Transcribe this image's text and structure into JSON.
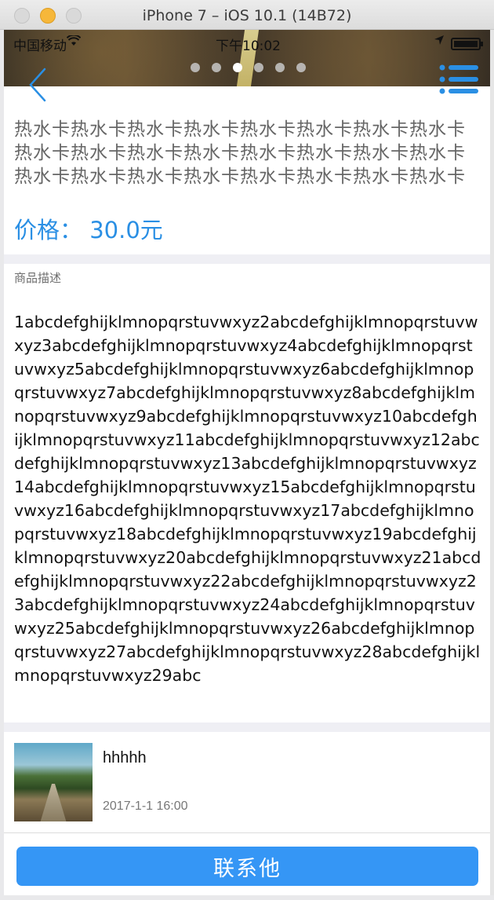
{
  "window": {
    "title": "iPhone 7 – iOS 10.1 (14B72)"
  },
  "status_bar": {
    "carrier": "中国移动",
    "wifi_icon": "wifi-icon",
    "time": "下午10:02",
    "location_icon": "location-arrow-icon",
    "battery_icon": "battery-icon"
  },
  "header": {
    "back_icon": "chevron-left-icon",
    "menu_icon": "list-menu-icon",
    "pager": {
      "count": 6,
      "active_index": 2
    }
  },
  "product": {
    "title": "热水卡热水卡热水卡热水卡热水卡热水卡热水卡热水卡热水卡热水卡热水卡热水卡热水卡热水卡热水卡热水卡热水卡热水卡热水卡热水卡热水卡热水卡热水卡热水卡",
    "price": "价格： 30.0元"
  },
  "description": {
    "label": "商品描述",
    "text": "1abcdefghijklmnopqrstuvwxyz2abcdefghijklmnopqrstuvwxyz3abcdefghijklmnopqrstuvwxyz4abcdefghijklmnopqrstuvwxyz5abcdefghijklmnopqrstuvwxyz6abcdefghijklmnopqrstuvwxyz7abcdefghijklmnopqrstuvwxyz8abcdefghijklmnopqrstuvwxyz9abcdefghijklmnopqrstuvwxyz10abcdefghijklmnopqrstuvwxyz11abcdefghijklmnopqrstuvwxyz12abcdefghijklmnopqrstuvwxyz13abcdefghijklmnopqrstuvwxyz14abcdefghijklmnopqrstuvwxyz15abcdefghijklmnopqrstuvwxyz16abcdefghijklmnopqrstuvwxyz17abcdefghijklmnopqrstuvwxyz18abcdefghijklmnopqrstuvwxyz19abcdefghijklmnopqrstuvwxyz20abcdefghijklmnopqrstuvwxyz21abcdefghijklmnopqrstuvwxyz22abcdefghijklmnopqrstuvwxyz23abcdefghijklmnopqrstuvwxyz24abcdefghijklmnopqrstuvwxyz25abcdefghijklmnopqrstuvwxyz26abcdefghijklmnopqrstuvwxyz27abcdefghijklmnopqrstuvwxyz28abcdefghijklmnopqrstuvwxyz29abc"
  },
  "seller": {
    "name": "hhhhh",
    "time": "2017-1-1 16:00"
  },
  "actions": {
    "contact_label": "联系他"
  },
  "colors": {
    "accent": "#2a8fe4",
    "button": "#3596f5",
    "separator": "#efeff4"
  }
}
